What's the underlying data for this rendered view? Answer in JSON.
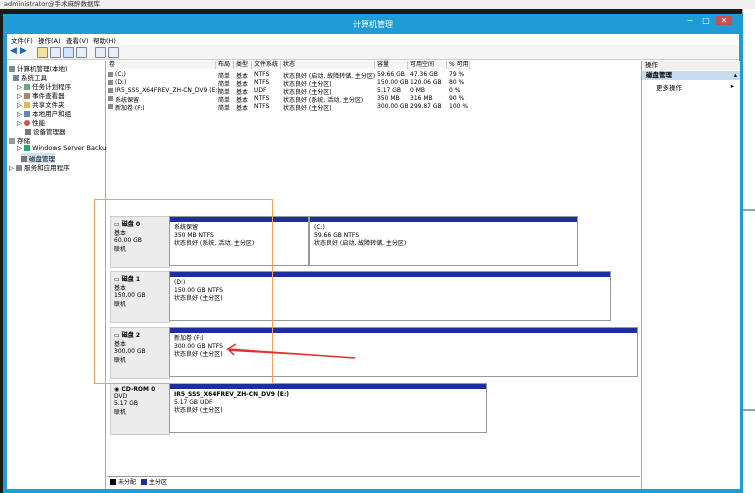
{
  "rdp": {
    "title": "administrator@手术麻醉数据库"
  },
  "window": {
    "title": "计算机管理",
    "btn_min": "−",
    "btn_max": "□",
    "btn_close": "✕"
  },
  "menu": [
    "文件(F)",
    "操作(A)",
    "查看(V)",
    "帮助(H)"
  ],
  "tree": {
    "root": "计算机管理(本地)",
    "system_tools": "系统工具",
    "items": [
      "任务计划程序",
      "事件查看器",
      "共享文件夹",
      "本地用户和组",
      "性能",
      "设备管理器"
    ],
    "storage": "存储",
    "storage_items": [
      "Windows Server Backup",
      "磁盘管理"
    ],
    "services": "服务和应用程序"
  },
  "list": {
    "headers": [
      "卷",
      "布局",
      "类型",
      "文件系统",
      "状态",
      "容量",
      "可用空间",
      "% 可用"
    ],
    "rows": [
      [
        "(C:)",
        "简单",
        "基本",
        "NTFS",
        "状态良好 (启动, 故障转储, 主分区)",
        "59.66 GB",
        "47.36 GB",
        "79 %"
      ],
      [
        "(D:)",
        "简单",
        "基本",
        "NTFS",
        "状态良好 (主分区)",
        "150.00 GB",
        "120.06 GB",
        "80 %"
      ],
      [
        "IR5_SSS_X64FREV_ZH-CN_DV9 (E:)",
        "简单",
        "基本",
        "UDF",
        "状态良好 (主分区)",
        "5.17 GB",
        "0 MB",
        "0 %"
      ],
      [
        "系统保留",
        "简单",
        "基本",
        "NTFS",
        "状态良好 (系统, 活动, 主分区)",
        "350 MB",
        "316 MB",
        "90 %"
      ],
      [
        "新加卷 (F:)",
        "简单",
        "基本",
        "NTFS",
        "状态良好 (主分区)",
        "300.00 GB",
        "299.87 GB",
        "100 %"
      ]
    ]
  },
  "disks": [
    {
      "name": "磁盘 0",
      "type": "基本",
      "size": "60.00 GB",
      "status": "联机",
      "parts": [
        {
          "name": "系统保留",
          "size": "350 MB NTFS",
          "status": "状态良好 (系统, 活动, 主分区)"
        },
        {
          "name": "(C:)",
          "size": "59.66 GB NTFS",
          "status": "状态良好 (启动, 故障转储, 主分区)"
        }
      ]
    },
    {
      "name": "磁盘 1",
      "type": "基本",
      "size": "150.00 GB",
      "status": "联机",
      "parts": [
        {
          "name": "(D:)",
          "size": "150.00 GB NTFS",
          "status": "状态良好 (主分区)"
        }
      ]
    },
    {
      "name": "磁盘 2",
      "type": "基本",
      "size": "300.00 GB",
      "status": "联机",
      "parts": [
        {
          "name": "新加卷 (F:)",
          "size": "300.00 GB NTFS",
          "status": "状态良好 (主分区)"
        }
      ]
    },
    {
      "name": "CD-ROM 0",
      "type": "DVD",
      "size": "5.17 GB",
      "status": "联机",
      "parts": [
        {
          "name": "IR5_SSS_X64FREV_ZH-CN_DV9 (E:)",
          "size": "5.17 GB UDF",
          "status": "状态良好 (主分区)"
        }
      ]
    }
  ],
  "legend": {
    "unallocated": "未分配",
    "primary": "主分区"
  },
  "actions": {
    "title": "操作",
    "section": "磁盘管理",
    "more": "更多操作"
  },
  "colors": {
    "title_bar": "#1e9cd8",
    "partition_header": "#1c2ea0",
    "annotation_arrow": "#e03030",
    "annotation_box": "#f0a060"
  }
}
